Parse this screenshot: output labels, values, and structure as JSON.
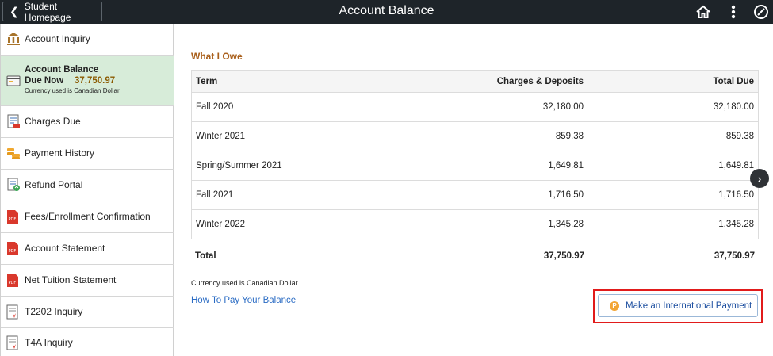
{
  "header": {
    "back_label": "Student Homepage",
    "title": "Account Balance",
    "icons": [
      "home-icon",
      "kebab-menu-icon",
      "navbar-icon"
    ]
  },
  "sidebar": {
    "items": [
      {
        "label": "Account Inquiry",
        "icon": "bank-icon"
      },
      {
        "label": "Account Balance",
        "due_label": "Due Now",
        "amount": "37,750.97",
        "currency_note": "Currency used is Canadian Dollar",
        "icon": "balance-icon",
        "active": true
      },
      {
        "label": "Charges Due",
        "icon": "charges-icon"
      },
      {
        "label": "Payment History",
        "icon": "coins-icon"
      },
      {
        "label": "Refund Portal",
        "icon": "refund-icon"
      },
      {
        "label": "Fees/Enrollment Confirmation",
        "icon": "pdf-icon"
      },
      {
        "label": "Account Statement",
        "icon": "pdf-icon"
      },
      {
        "label": "Net Tuition Statement",
        "icon": "pdf-icon"
      },
      {
        "label": "T2202 Inquiry",
        "icon": "tax-form-icon"
      },
      {
        "label": "T4A Inquiry",
        "icon": "tax-form-icon"
      }
    ]
  },
  "main": {
    "section_title": "What I Owe",
    "columns": [
      "Term",
      "Charges & Deposits",
      "Total Due"
    ],
    "rows": [
      {
        "term": "Fall 2020",
        "charges": "32,180.00",
        "total": "32,180.00"
      },
      {
        "term": "Winter 2021",
        "charges": "859.38",
        "total": "859.38"
      },
      {
        "term": "Spring/Summer 2021",
        "charges": "1,649.81",
        "total": "1,649.81"
      },
      {
        "term": "Fall 2021",
        "charges": "1,716.50",
        "total": "1,716.50"
      },
      {
        "term": "Winter 2022",
        "charges": "1,345.28",
        "total": "1,345.28"
      }
    ],
    "total": {
      "label": "Total",
      "charges": "37,750.97",
      "total": "37,750.97"
    },
    "currency_note": "Currency used is Canadian Dollar.",
    "pay_link": "How To Pay Your Balance",
    "intl_button": "Make an International Payment",
    "intl_icon_text": "P"
  },
  "colors": {
    "topbar": "#1e2429",
    "active_nav": "#d7ecd9",
    "section_title": "#a95f1b",
    "link": "#2b6cc4",
    "highlight": "#e11b1b"
  }
}
